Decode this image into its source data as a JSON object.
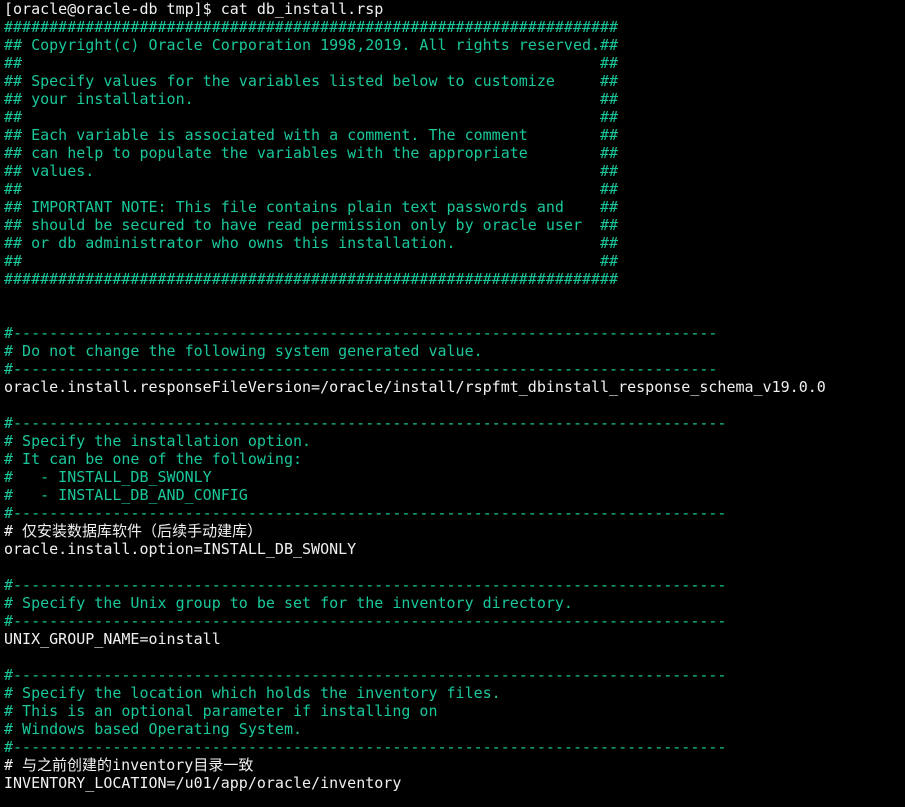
{
  "terminal": {
    "colors": {
      "background": "#000000",
      "output": "#f0f0f0",
      "comment": "#19c79b"
    },
    "lines": [
      {
        "text": "[oracle@oracle-db tmp]$ cat db_install.rsp",
        "kind": "white"
      },
      {
        "text": "####################################################################",
        "kind": "green"
      },
      {
        "text": "## Copyright(c) Oracle Corporation 1998,2019. All rights reserved.##",
        "kind": "green"
      },
      {
        "text": "##                                                                ##",
        "kind": "green"
      },
      {
        "text": "## Specify values for the variables listed below to customize     ##",
        "kind": "green"
      },
      {
        "text": "## your installation.                                             ##",
        "kind": "green"
      },
      {
        "text": "##                                                                ##",
        "kind": "green"
      },
      {
        "text": "## Each variable is associated with a comment. The comment        ##",
        "kind": "green"
      },
      {
        "text": "## can help to populate the variables with the appropriate        ##",
        "kind": "green"
      },
      {
        "text": "## values.                                                        ##",
        "kind": "green"
      },
      {
        "text": "##                                                                ##",
        "kind": "green"
      },
      {
        "text": "## IMPORTANT NOTE: This file contains plain text passwords and    ##",
        "kind": "green"
      },
      {
        "text": "## should be secured to have read permission only by oracle user  ##",
        "kind": "green"
      },
      {
        "text": "## or db administrator who owns this installation.                ##",
        "kind": "green"
      },
      {
        "text": "##                                                                ##",
        "kind": "green"
      },
      {
        "text": "####################################################################",
        "kind": "green"
      },
      {
        "text": "",
        "kind": "blank"
      },
      {
        "text": "",
        "kind": "blank"
      },
      {
        "text": "#------------------------------------------------------------------------------",
        "kind": "green"
      },
      {
        "text": "# Do not change the following system generated value.",
        "kind": "green"
      },
      {
        "text": "#------------------------------------------------------------------------------",
        "kind": "green"
      },
      {
        "text": "oracle.install.responseFileVersion=/oracle/install/rspfmt_dbinstall_response_schema_v19.0.0",
        "kind": "white"
      },
      {
        "text": "",
        "kind": "blank"
      },
      {
        "text": "#-------------------------------------------------------------------------------",
        "kind": "green"
      },
      {
        "text": "# Specify the installation option.",
        "kind": "green"
      },
      {
        "text": "# It can be one of the following:",
        "kind": "green"
      },
      {
        "text": "#   - INSTALL_DB_SWONLY",
        "kind": "green"
      },
      {
        "text": "#   - INSTALL_DB_AND_CONFIG",
        "kind": "green"
      },
      {
        "text": "#-------------------------------------------------------------------------------",
        "kind": "green"
      },
      {
        "text": "# 仅安装数据库软件（后续手动建库）",
        "kind": "white"
      },
      {
        "text": "oracle.install.option=INSTALL_DB_SWONLY",
        "kind": "white"
      },
      {
        "text": "",
        "kind": "blank"
      },
      {
        "text": "#-------------------------------------------------------------------------------",
        "kind": "green"
      },
      {
        "text": "# Specify the Unix group to be set for the inventory directory.",
        "kind": "green"
      },
      {
        "text": "#-------------------------------------------------------------------------------",
        "kind": "green"
      },
      {
        "text": "UNIX_GROUP_NAME=oinstall",
        "kind": "white"
      },
      {
        "text": "",
        "kind": "blank"
      },
      {
        "text": "#-------------------------------------------------------------------------------",
        "kind": "green"
      },
      {
        "text": "# Specify the location which holds the inventory files.",
        "kind": "green"
      },
      {
        "text": "# This is an optional parameter if installing on",
        "kind": "green"
      },
      {
        "text": "# Windows based Operating System.",
        "kind": "green"
      },
      {
        "text": "#-------------------------------------------------------------------------------",
        "kind": "green"
      },
      {
        "text": "# 与之前创建的inventory目录一致",
        "kind": "white"
      },
      {
        "text": "INVENTORY_LOCATION=/u01/app/oracle/inventory",
        "kind": "white"
      }
    ]
  }
}
